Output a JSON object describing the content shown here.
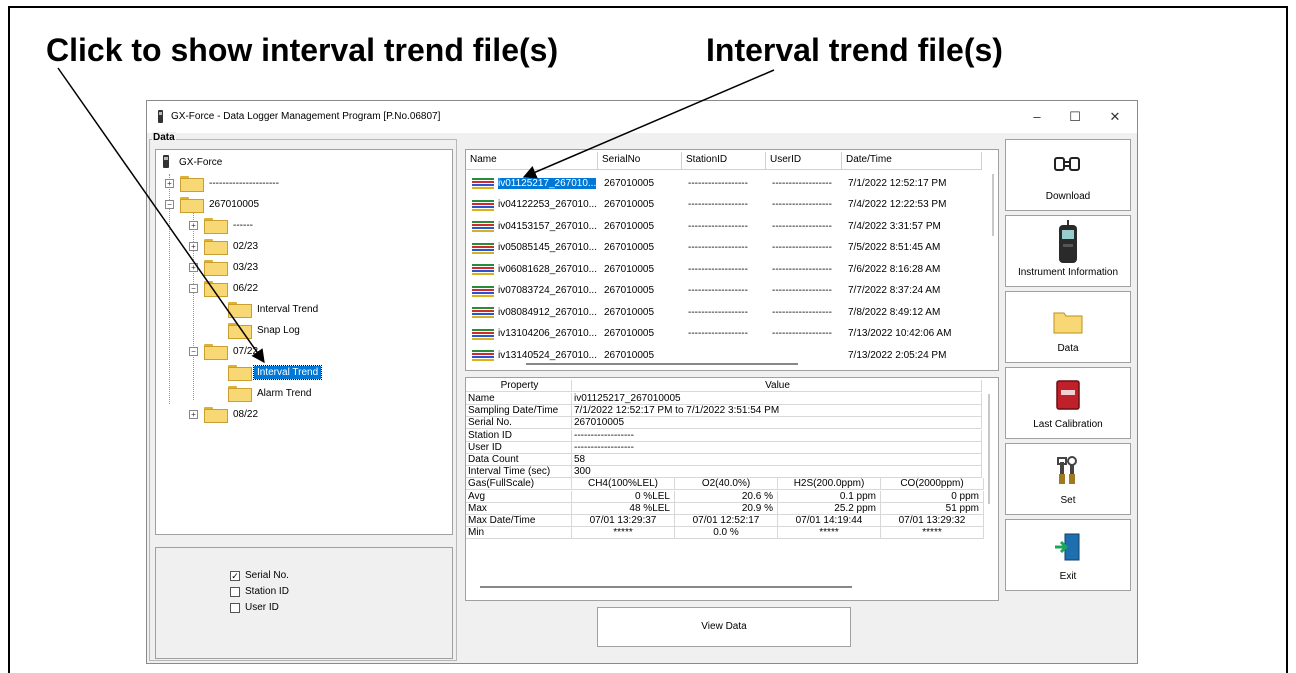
{
  "callouts": {
    "left": "Click to show interval trend file(s)",
    "right": "Interval trend file(s)"
  },
  "window": {
    "title": "GX-Force - Data Logger Management Program [P.No.06807]",
    "controls": {
      "minimize": "–",
      "maximize": "☐",
      "close": "✕"
    }
  },
  "data_group": {
    "legend": "Data"
  },
  "tree": {
    "root": "GX-Force",
    "n1": "---------------------",
    "n2": "267010005",
    "n3": "------",
    "n4": "02/23",
    "n5": "03/23",
    "n6": "06/22",
    "n7": "Interval Trend",
    "n8": "Snap Log",
    "n9": "07/22",
    "n10": "Interval Trend",
    "n11": "Alarm Trend",
    "n12": "08/22"
  },
  "options": {
    "serial": "Serial No.",
    "station": "Station ID",
    "user": "User ID",
    "serial_checked": "✓"
  },
  "filelist": {
    "columns": [
      "Name",
      "SerialNo",
      "StationID",
      "UserID",
      "Date/Time"
    ],
    "rows": [
      {
        "name": "iv01125217_267010...",
        "serial": "267010005",
        "station": "------------------",
        "user": "------------------",
        "date": "7/1/2022 12:52:17 PM"
      },
      {
        "name": "iv04122253_267010...",
        "serial": "267010005",
        "station": "------------------",
        "user": "------------------",
        "date": "7/4/2022 12:22:53 PM"
      },
      {
        "name": "iv04153157_267010...",
        "serial": "267010005",
        "station": "------------------",
        "user": "------------------",
        "date": "7/4/2022 3:31:57 PM"
      },
      {
        "name": "iv05085145_267010...",
        "serial": "267010005",
        "station": "------------------",
        "user": "------------------",
        "date": "7/5/2022 8:51:45 AM"
      },
      {
        "name": "iv06081628_267010...",
        "serial": "267010005",
        "station": "------------------",
        "user": "------------------",
        "date": "7/6/2022 8:16:28 AM"
      },
      {
        "name": "iv07083724_267010...",
        "serial": "267010005",
        "station": "------------------",
        "user": "------------------",
        "date": "7/7/2022 8:37:24 AM"
      },
      {
        "name": "iv08084912_267010...",
        "serial": "267010005",
        "station": "------------------",
        "user": "------------------",
        "date": "7/8/2022 8:49:12 AM"
      },
      {
        "name": "iv13104206_267010...",
        "serial": "267010005",
        "station": "------------------",
        "user": "------------------",
        "date": "7/13/2022 10:42:06 AM"
      },
      {
        "name": "iv13140524_267010...",
        "serial": "267010005",
        "station": "",
        "user": "",
        "date": "7/13/2022 2:05:24 PM"
      }
    ]
  },
  "props": {
    "h_property": "Property",
    "h_value": "Value",
    "rows": [
      {
        "k": "Name",
        "v": "iv01125217_267010005"
      },
      {
        "k": "Sampling Date/Time",
        "v": "7/1/2022 12:52:17 PM to 7/1/2022 3:51:54 PM"
      },
      {
        "k": "Serial No.",
        "v": "267010005"
      },
      {
        "k": "Station ID",
        "v": "------------------"
      },
      {
        "k": "User ID",
        "v": "------------------"
      },
      {
        "k": "Data Count",
        "v": "58"
      },
      {
        "k": "Interval Time (sec)",
        "v": "300"
      }
    ],
    "gas_label": "Gas(FullScale)",
    "gases": [
      "CH4(100%LEL)",
      "O2(40.0%)",
      "H2S(200.0ppm)",
      "CO(2000ppm)"
    ],
    "avg_label": "Avg",
    "avg": [
      "0 %LEL",
      "20.6 %",
      "0.1 ppm",
      "0 ppm"
    ],
    "max_label": "Max",
    "max": [
      "48 %LEL",
      "20.9 %",
      "25.2 ppm",
      "51 ppm"
    ],
    "maxdt_label": "Max Date/Time",
    "maxdt": [
      "07/01 13:29:37",
      "07/01 12:52:17",
      "07/01 14:19:44",
      "07/01 13:29:32"
    ],
    "min_label": "Min",
    "min": [
      "*****",
      "0.0 %",
      "*****",
      "*****"
    ]
  },
  "view_data_label": "View Data",
  "side_buttons": {
    "download": "Download",
    "instrument": "Instrument Information",
    "data": "Data",
    "calibration": "Last Calibration",
    "set": "Set",
    "exit": "Exit"
  },
  "colors": {
    "selection": "#0078d7",
    "folder": "#f8d775",
    "window_bg": "#f0f0f0"
  }
}
